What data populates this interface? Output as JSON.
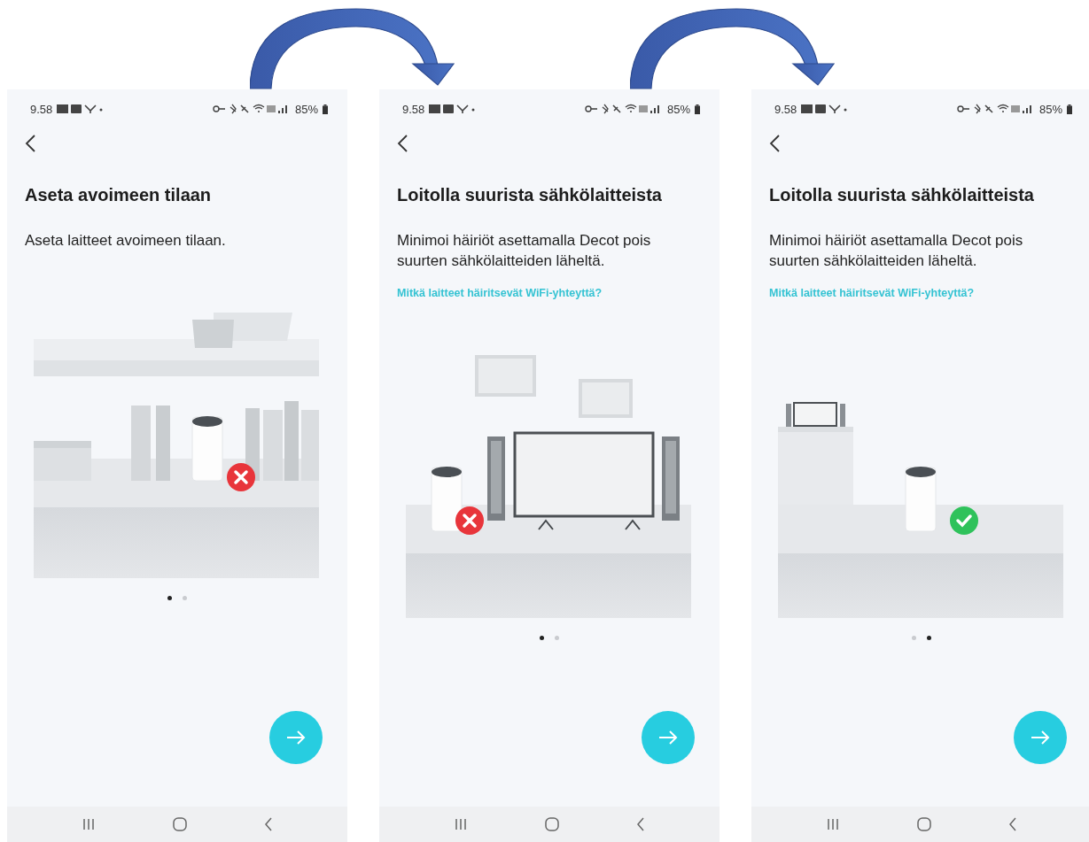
{
  "screens": [
    {
      "status_time": "9.58",
      "battery": "85%",
      "title": "Aseta avoimeen tilaan",
      "description": "Aseta laitteet avoimeen tilaan.",
      "kind": "shelf",
      "badge": {
        "kind": "cross"
      },
      "dots": [
        {
          "selected": true
        },
        {
          "selected": false
        }
      ]
    },
    {
      "status_time": "9.58",
      "battery": "85%",
      "title": "Loitolla suurista sähkölaitteista",
      "description": "Minimoi häiriöt asettamalla Decot pois suurten sähkölaitteiden läheltä.",
      "link": "Mitkä laitteet häiritsevät WiFi-yhteyttä?",
      "kind": "tv_near",
      "badge": {
        "kind": "cross"
      },
      "dots": [
        {
          "selected": true
        },
        {
          "selected": false
        }
      ]
    },
    {
      "status_time": "9.58",
      "battery": "85%",
      "title": "Loitolla suurista sähkölaitteista",
      "description": "Minimoi häiriöt asettamalla Decot pois suurten sähkölaitteiden läheltä.",
      "link": "Mitkä laitteet häiritsevät WiFi-yhteyttä?",
      "kind": "tv_far",
      "badge": {
        "kind": "check"
      },
      "dots": [
        {
          "selected": false
        },
        {
          "selected": true
        }
      ]
    }
  ]
}
